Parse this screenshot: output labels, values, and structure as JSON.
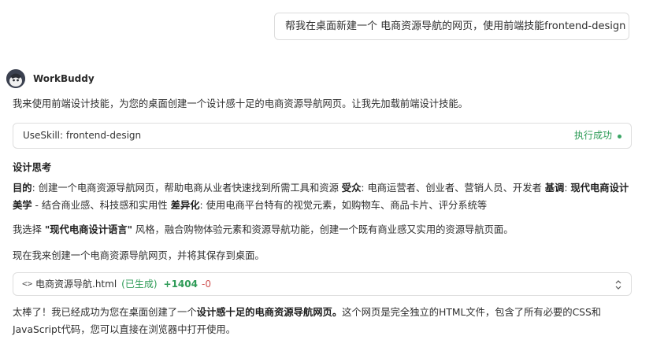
{
  "user_message": "帮我在桌面新建一个 电商资源导航的网页，使用前端技能frontend-design",
  "agent": {
    "name": "WorkBuddy",
    "intro": "我来使用前端设计技能，为您的桌面创建一个设计感十足的电商资源导航网页。让我先加载前端设计技能。"
  },
  "tool_call": {
    "label": "UseSkill: frontend-design",
    "status": "执行成功",
    "status_color": "#2e9b57"
  },
  "thinking": {
    "heading": "设计思考",
    "goal_label": "目的",
    "goal_text": ": 创建一个电商资源导航网页，帮助电商从业者快速找到所需工具和资源 ",
    "audience_label": "受众",
    "audience_text": ": 电商运营者、创业者、营销人员、开发者 ",
    "tone_label": "基调",
    "tone_sep": ": ",
    "tone_value": "现代电商设计美学",
    "tone_text": " - 结合商业感、科技感和实用性 ",
    "diff_label": "差异化",
    "diff_text": ": 使用电商平台特有的视觉元素，如购物车、商品卡片、评分系统等"
  },
  "style_choice": {
    "prefix": "我选择 ",
    "highlight": "\"现代电商设计语言\"",
    "suffix": " 风格，融合购物体验元素和资源导航功能，创建一个既有商业感又实用的资源导航页面。"
  },
  "create_note": "现在我来创建一个电商资源导航网页，并将其保存到桌面。",
  "file_change": {
    "icon": "<>",
    "filename": "电商资源导航.html",
    "state": "(已生成)",
    "additions": "+1404",
    "deletions": "-0"
  },
  "final_message": {
    "prefix": "太棒了！我已经成功为您在桌面创建了一个",
    "highlight": "设计感十足的电商资源导航网页。",
    "suffix": "这个网页是完全独立的HTML文件，包含了所有必要的CSS和JavaScript代码，您可以直接在浏览器中打开使用。"
  }
}
